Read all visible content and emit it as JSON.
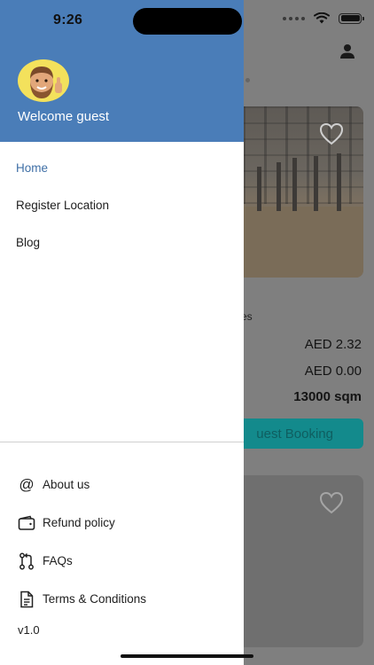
{
  "status": {
    "time": "9:26"
  },
  "drawer": {
    "welcome": "Welcome guest",
    "nav": [
      {
        "label": "Home",
        "active": true
      },
      {
        "label": "Register Location"
      },
      {
        "label": "Blog"
      }
    ],
    "footer": [
      {
        "label": "About us",
        "icon": "at-icon"
      },
      {
        "label": "Refund policy",
        "icon": "wallet-icon"
      },
      {
        "label": "FAQs",
        "icon": "pull-request-icon"
      },
      {
        "label": "Terms & Conditions",
        "icon": "document-icon"
      }
    ],
    "version": "v1.0"
  },
  "background": {
    "partial_text": "es",
    "price1": "AED 2.32",
    "price2": "AED 0.00",
    "area": "13000 sqm",
    "button": "uest Booking"
  },
  "colors": {
    "header": "#4a7db8",
    "active": "#3f6fa6",
    "button": "#138a8c"
  }
}
